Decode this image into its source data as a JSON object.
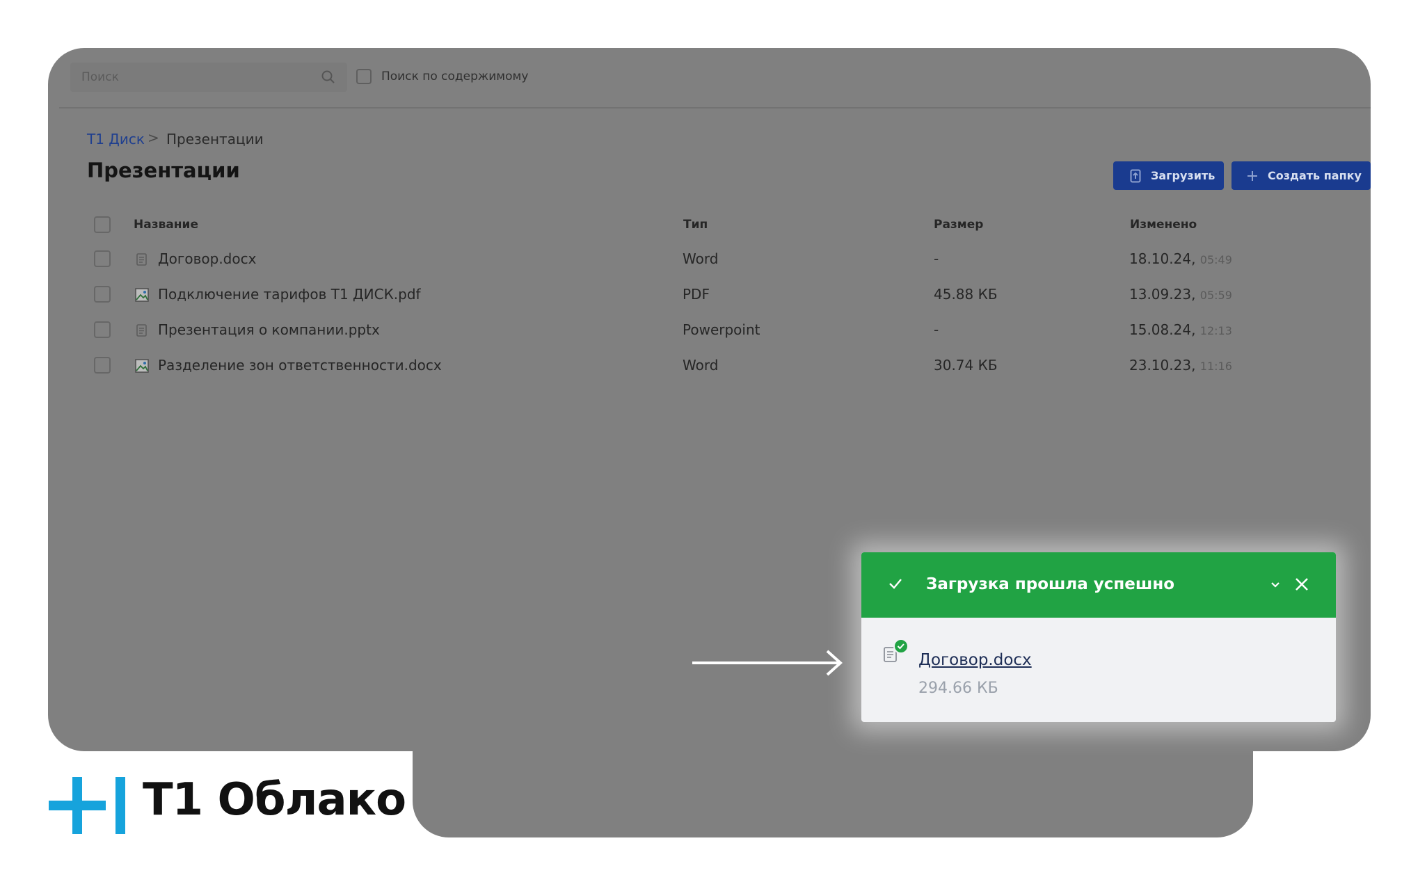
{
  "search": {
    "placeholder": "Поиск",
    "content_search_label": "Поиск по содержимому",
    "content_search_checked": false
  },
  "breadcrumb": {
    "root": "Т1 Диск",
    "separator": ">",
    "current": "Презентации"
  },
  "page_title": "Презентации",
  "toolbar": {
    "upload_label": "Загрузить",
    "create_folder_label": "Создать папку",
    "button_color": "#1a3b8f"
  },
  "table": {
    "headers": {
      "name": "Название",
      "type": "Тип",
      "size": "Размер",
      "modified": "Изменено"
    },
    "rows": [
      {
        "name": "Договор.docx",
        "icon": "document-icon",
        "type": "Word",
        "size": "-",
        "date": "18.10.24,",
        "time": "05:49"
      },
      {
        "name": "Подключение тарифов Т1 ДИСК.pdf",
        "icon": "image-icon",
        "type": "PDF",
        "size": "45.88 КБ",
        "date": "13.09.23,",
        "time": "05:59"
      },
      {
        "name": "Презентация о компании.pptx",
        "icon": "document-icon",
        "type": "Powerpoint",
        "size": "-",
        "date": "15.08.24,",
        "time": "12:13"
      },
      {
        "name": "Разделение зон ответственности.docx",
        "icon": "image-icon",
        "type": "Word",
        "size": "30.74 КБ",
        "date": "23.10.23,",
        "time": "11:16"
      }
    ]
  },
  "toast": {
    "title": "Загрузка прошла успешно",
    "file_name": "Договор.docx",
    "file_size": "294.66 КБ",
    "accent": "#21a344"
  },
  "brand": {
    "logo_text": "T1 Облако",
    "logo_color": "#16a3dc"
  }
}
